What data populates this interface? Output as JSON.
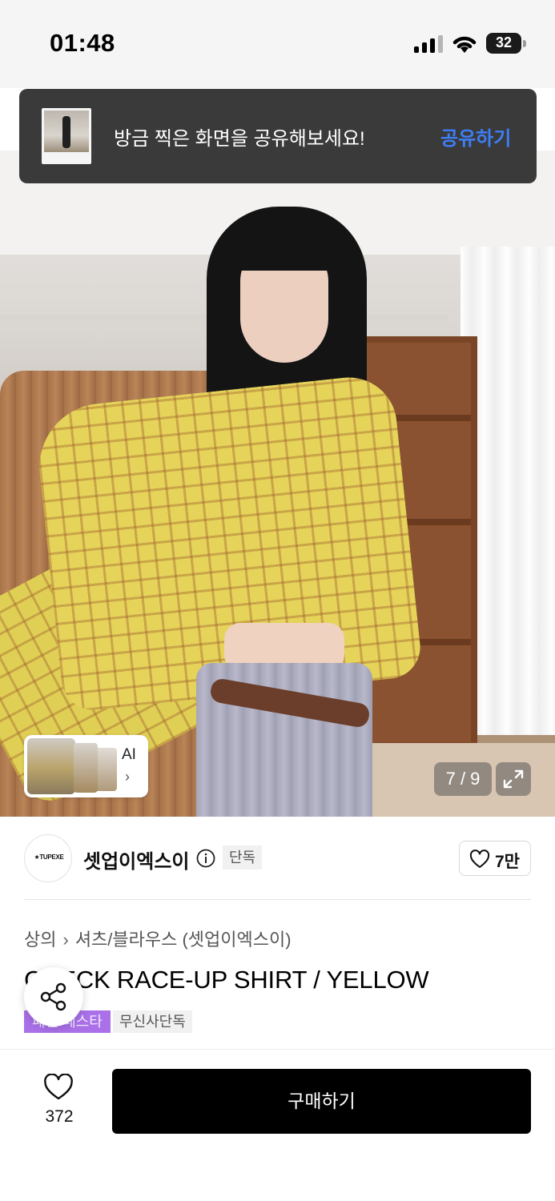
{
  "status_bar": {
    "time": "01:48",
    "battery": "32"
  },
  "toast": {
    "message": "방금 찍은 화면을 공유해보세요!",
    "action": "공유하기",
    "action_color": "#3d7ef5"
  },
  "gallery": {
    "ai_label": "AI",
    "ai_chevron": "›",
    "page_counter": "7 / 9",
    "current_page": 7,
    "total_pages": 9
  },
  "seller": {
    "logo_text": "★TUPEXE",
    "name": "셋업이엑스이",
    "exclusive_tag": "단독",
    "like_count": "7만"
  },
  "product": {
    "breadcrumb": [
      "상의",
      "셔츠/블라우스 (셋업이엑스이)"
    ],
    "breadcrumb_separator": "›",
    "title": "CHECK RACE-UP SHIRT / YELLOW",
    "tags": [
      "패션 페스타",
      "무신사단독"
    ],
    "tag_purple_color": "#a970e8"
  },
  "bottom_bar": {
    "wish_count": "372",
    "buy_label": "구매하기"
  },
  "icons": {
    "share": "share-icon",
    "heart": "heart-outline-icon",
    "expand": "expand-icon",
    "info": "info-icon",
    "wifi": "wifi-icon",
    "signal": "signal-icon"
  }
}
